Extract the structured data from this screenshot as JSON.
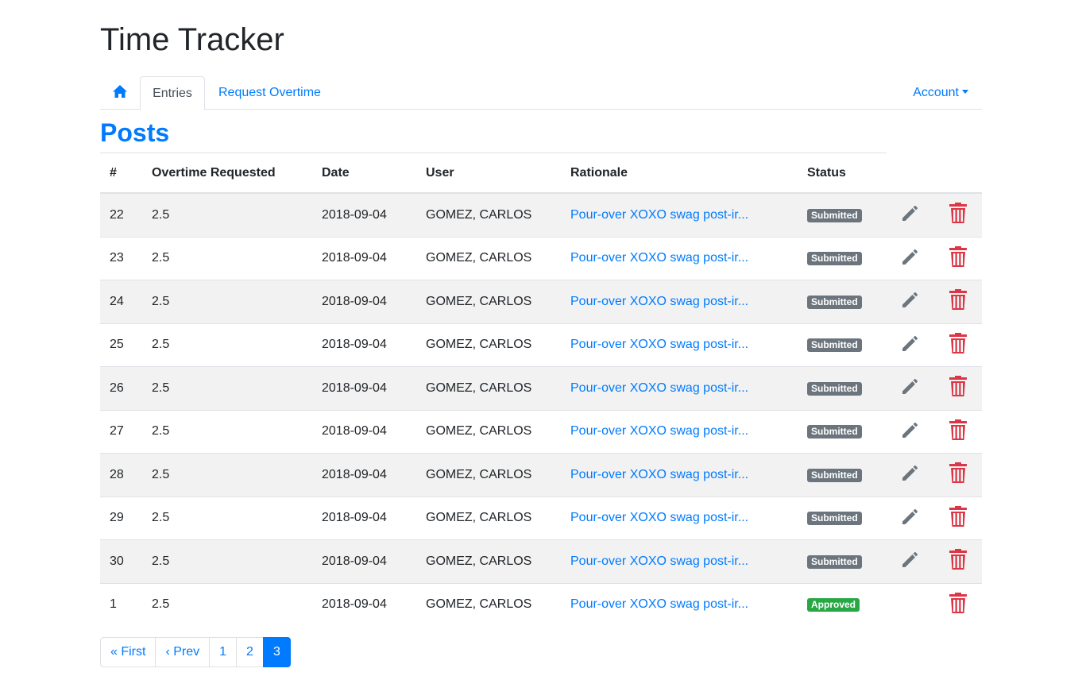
{
  "app": {
    "title": "Time Tracker"
  },
  "nav": {
    "home_icon": "home-icon",
    "entries_label": "Entries",
    "overtime_label": "Request Overtime",
    "account_label": "Account"
  },
  "section": {
    "title": "Posts"
  },
  "table": {
    "headers": [
      "#",
      "Overtime Requested",
      "Date",
      "User",
      "Rationale",
      "Status"
    ],
    "rows": [
      {
        "id": "22",
        "overtime": "2.5",
        "date": "2018-09-04",
        "user": "GOMEZ, CARLOS",
        "rationale": "Pour-over XOXO swag post-ir...",
        "status": "Submitted"
      },
      {
        "id": "23",
        "overtime": "2.5",
        "date": "2018-09-04",
        "user": "GOMEZ, CARLOS",
        "rationale": "Pour-over XOXO swag post-ir...",
        "status": "Submitted"
      },
      {
        "id": "24",
        "overtime": "2.5",
        "date": "2018-09-04",
        "user": "GOMEZ, CARLOS",
        "rationale": "Pour-over XOXO swag post-ir...",
        "status": "Submitted"
      },
      {
        "id": "25",
        "overtime": "2.5",
        "date": "2018-09-04",
        "user": "GOMEZ, CARLOS",
        "rationale": "Pour-over XOXO swag post-ir...",
        "status": "Submitted"
      },
      {
        "id": "26",
        "overtime": "2.5",
        "date": "2018-09-04",
        "user": "GOMEZ, CARLOS",
        "rationale": "Pour-over XOXO swag post-ir...",
        "status": "Submitted"
      },
      {
        "id": "27",
        "overtime": "2.5",
        "date": "2018-09-04",
        "user": "GOMEZ, CARLOS",
        "rationale": "Pour-over XOXO swag post-ir...",
        "status": "Submitted"
      },
      {
        "id": "28",
        "overtime": "2.5",
        "date": "2018-09-04",
        "user": "GOMEZ, CARLOS",
        "rationale": "Pour-over XOXO swag post-ir...",
        "status": "Submitted"
      },
      {
        "id": "29",
        "overtime": "2.5",
        "date": "2018-09-04",
        "user": "GOMEZ, CARLOS",
        "rationale": "Pour-over XOXO swag post-ir...",
        "status": "Submitted"
      },
      {
        "id": "30",
        "overtime": "2.5",
        "date": "2018-09-04",
        "user": "GOMEZ, CARLOS",
        "rationale": "Pour-over XOXO swag post-ir...",
        "status": "Submitted"
      },
      {
        "id": "1",
        "overtime": "2.5",
        "date": "2018-09-04",
        "user": "GOMEZ, CARLOS",
        "rationale": "Pour-over XOXO swag post-ir...",
        "status": "Approved"
      }
    ],
    "edit_icon": "pencil-icon",
    "delete_icon": "trash-icon"
  },
  "pagination": {
    "first": "« First",
    "prev": "‹ Prev",
    "pages": [
      "1",
      "2",
      "3"
    ],
    "current": "3"
  },
  "colors": {
    "primary": "#007bff",
    "submitted": "#6c757d",
    "approved": "#28a745",
    "danger": "#dc3545",
    "edit": "#6c757d"
  }
}
